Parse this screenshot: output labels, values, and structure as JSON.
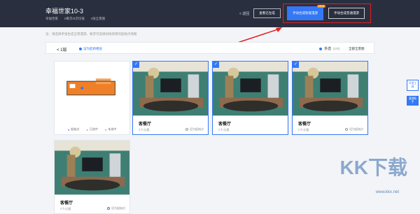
{
  "header": {
    "title": "幸福世家10-3",
    "meta": [
      "幸福世家",
      "0東次/0次均值",
      "4张全景图"
    ],
    "back": "< 返回",
    "generate": "查看已生成",
    "smart_btn": "手动合成智能漫游",
    "new_badge": "NEW",
    "normal_btn": "手动合成普通漫游"
  },
  "note": "注：请选择单张生成全景漫游，要求可选择初始场景的起始点地图",
  "toolbar": {
    "floor": "< 1层",
    "set_start": "设为起始楼层",
    "multi": "多选",
    "count": "(1/4)",
    "all": "全部全景图"
  },
  "plan_legend": [
    "起始点",
    "已选中",
    "未选中"
  ],
  "cards": [
    {
      "name": "客餐厅",
      "sub": "2个/元相",
      "set": "设为起始点",
      "active": false
    },
    {
      "name": "客餐厅",
      "sub": "2个/元相",
      "set": "",
      "active": false
    },
    {
      "name": "客餐厅",
      "sub": "2个/元相",
      "set": "设为起始点",
      "active": false
    },
    {
      "name": "客餐厅",
      "sub": "2个/元相",
      "set": "设为起始点",
      "active": true
    },
    {
      "name": "客餐厅",
      "sub": "",
      "set": "",
      "active": false
    }
  ],
  "side": {
    "top": "开发工具",
    "bottom": "漫游助手"
  },
  "watermark": {
    "big": "KK下载",
    "url": "www.kkx.net"
  }
}
